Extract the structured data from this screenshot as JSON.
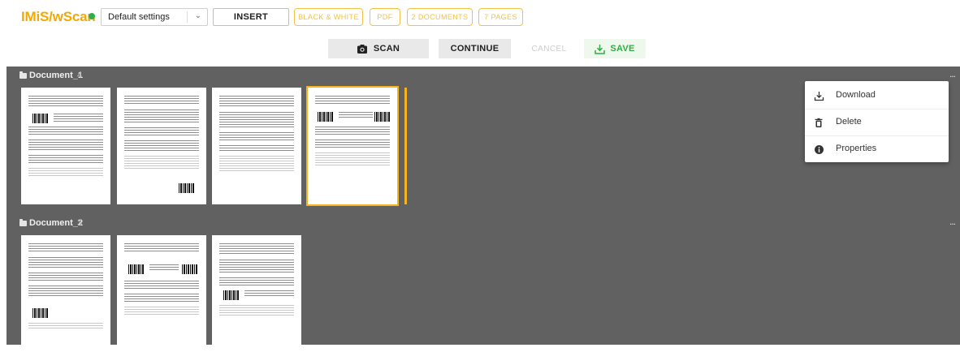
{
  "app": {
    "logo": "IMiS/wScan",
    "status_color": "#2eae4f",
    "accent_color": "#f5a800"
  },
  "toolbar": {
    "settings_value": "Default settings",
    "insert_label": "INSERT",
    "chips": [
      "BLACK & WHITE",
      "PDF",
      "2 DOCUMENTS",
      "7 PAGES"
    ]
  },
  "actions": {
    "scan_label": "SCAN",
    "continue_label": "CONTINUE",
    "cancel_label": "CANCEL",
    "save_label": "SAVE"
  },
  "documents": [
    {
      "name": "Document_1",
      "count": "4",
      "pages": 4,
      "selected_page": 4
    },
    {
      "name": "Document_2",
      "count": "3",
      "pages": 3
    }
  ],
  "context_menu": {
    "items": [
      {
        "label": "Download",
        "icon": "download-icon"
      },
      {
        "label": "Delete",
        "icon": "trash-icon"
      },
      {
        "label": "Properties",
        "icon": "info-icon"
      }
    ]
  },
  "more_label": "..."
}
